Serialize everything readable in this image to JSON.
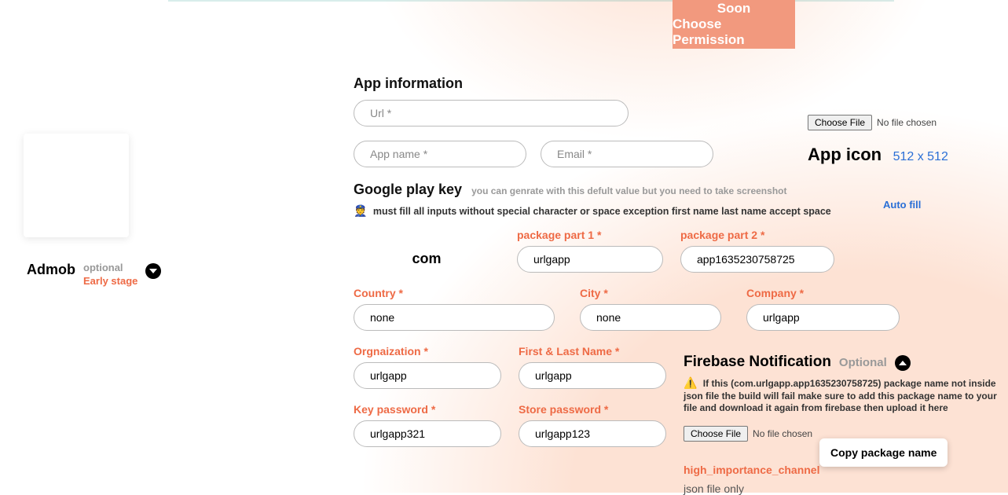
{
  "banner": {
    "line1": "Soon",
    "line2": "Choose Permission"
  },
  "sidebar": {
    "admob": "Admob",
    "optional": "optional",
    "early": "Early stage"
  },
  "app_info": {
    "title": "App information",
    "url_placeholder": "Url *",
    "name_placeholder": "App name *",
    "email_placeholder": "Email *"
  },
  "icon": {
    "choose": "Choose File",
    "nofile": "No file chosen",
    "title": "App icon",
    "dims": "512 x 512"
  },
  "auto_fill": "Auto fill",
  "gpk": {
    "title": "Google play key",
    "hint": "you can genrate with this defult value but you need to take screenshot",
    "warn": "must fill all inputs without special character or space exception first name last name accept space",
    "pkg1_label": "package part 1 *",
    "pkg2_label": "package part 2 *",
    "com": "com",
    "pkg1_value": "urlgapp",
    "pkg2_value": "app1635230758725",
    "country_label": "Country *",
    "country_value": "none",
    "city_label": "City *",
    "city_value": "none",
    "company_label": "Company *",
    "company_value": "urlgapp",
    "org_label": "Orgnaization *",
    "org_value": "urlgapp",
    "name_label": "First & Last Name *",
    "name_value": "urlgapp",
    "keypw_label": "Key password *",
    "keypw_value": "urlgapp321",
    "storepw_label": "Store password *",
    "storepw_value": "urlgapp123"
  },
  "firebase": {
    "title": "Firebase Notification",
    "optional": "Optional",
    "warn": "If this (com.urlgapp.app1635230758725) package name not inside json file the build will fail make sure to add this package name to your file and download it again from firebase then upload it here",
    "choose": "Choose File",
    "nofile": "No file chosen",
    "channel": "high_importance_channel",
    "json_only": "json file only",
    "copy": "Copy package name"
  }
}
